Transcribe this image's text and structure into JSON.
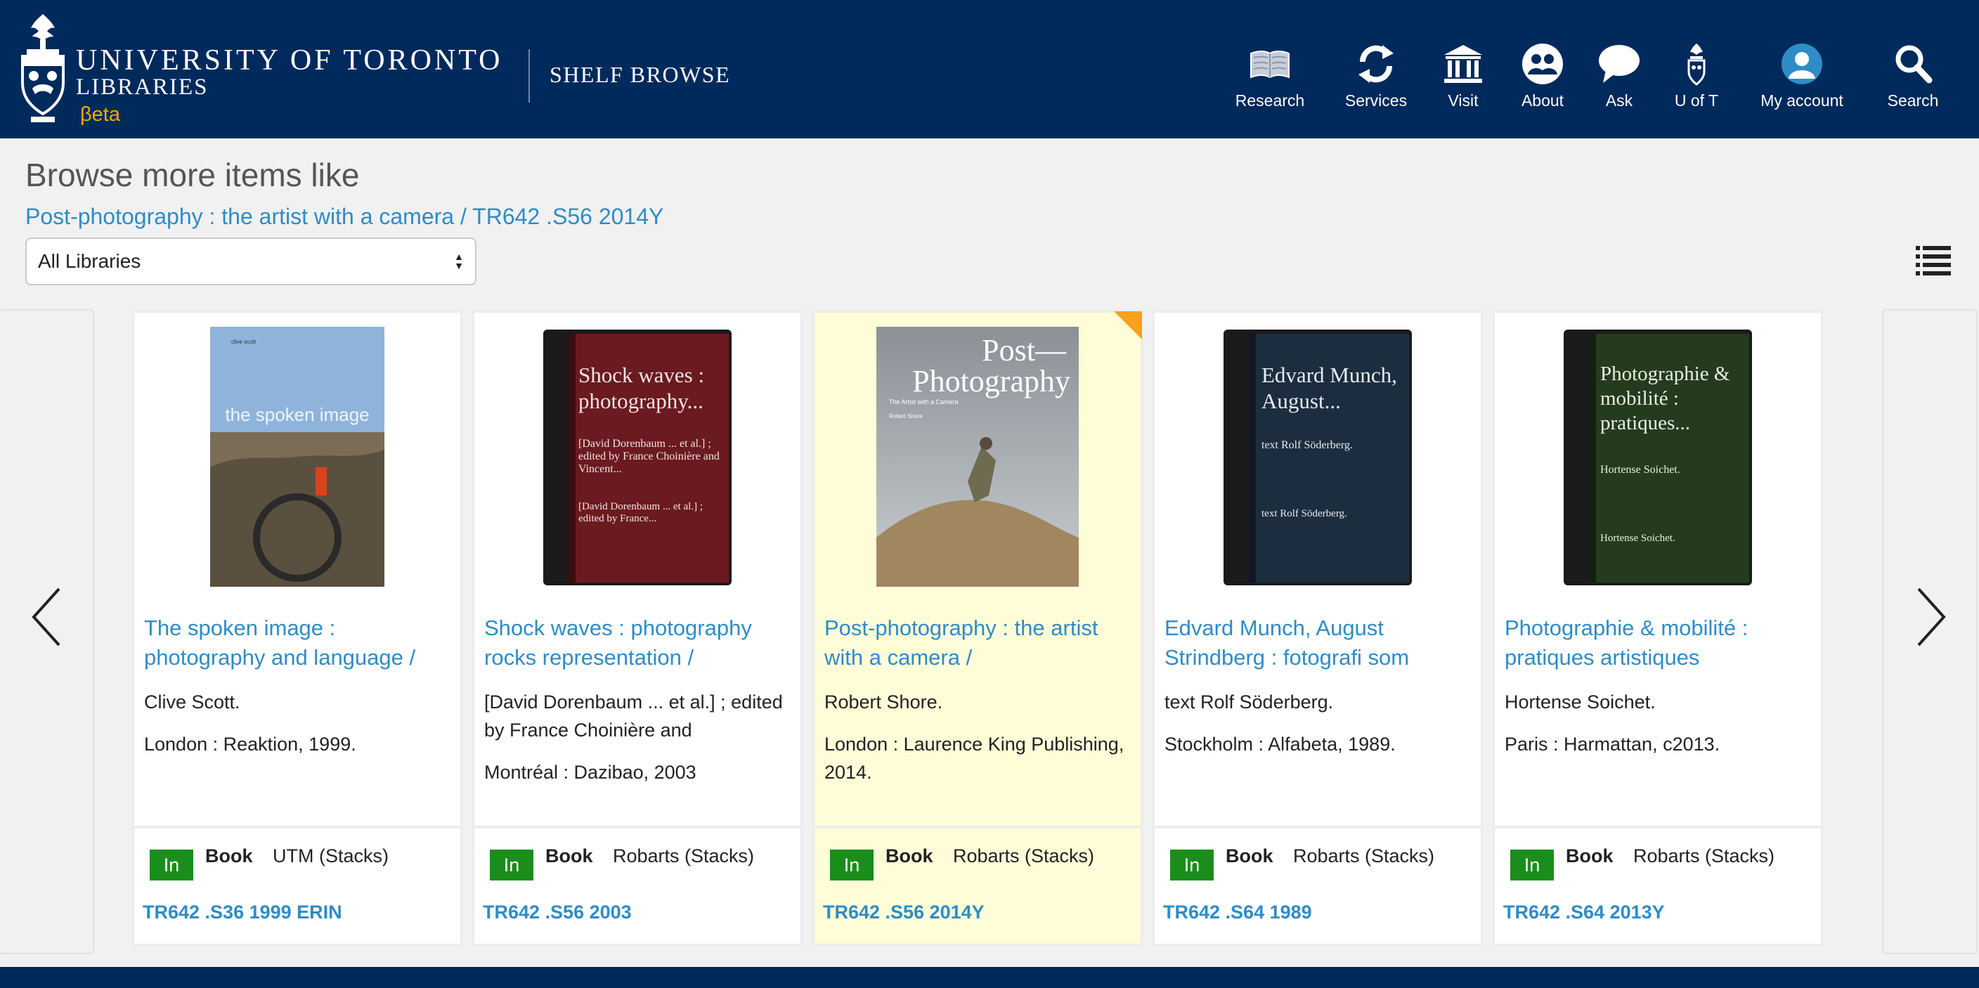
{
  "header": {
    "org_line1": "UNIVERSITY OF TORONTO",
    "org_line2": "LIBRARIES",
    "beta": "βeta",
    "app_title": "SHELF BROWSE",
    "nav": [
      {
        "label": "Research",
        "icon": "book-icon"
      },
      {
        "label": "Services",
        "icon": "refresh-icon"
      },
      {
        "label": "Visit",
        "icon": "building-icon"
      },
      {
        "label": "About",
        "icon": "people-icon"
      },
      {
        "label": "Ask",
        "icon": "chat-bubble-icon"
      },
      {
        "label": "U of T",
        "icon": "crest-icon"
      },
      {
        "label": "My account",
        "icon": "user-icon"
      },
      {
        "label": "Search",
        "icon": "search-icon"
      }
    ]
  },
  "browse": {
    "heading": "Browse more items like",
    "current_item": "Post-photography : the artist with a camera / TR642 .S56 2014Y",
    "library_filter": "All Libraries"
  },
  "items": [
    {
      "title": "The spoken image : photography and language /",
      "author": "Clive Scott.",
      "publication": "London : Reaktion, 1999.",
      "status": "In",
      "type": "Book",
      "location": "UTM (Stacks)",
      "call_number": "TR642 .S36 1999 ERIN",
      "cover_text": "the spoken image",
      "cover_small_text": "clive scott"
    },
    {
      "title": "Shock waves : photography rocks representation /",
      "author": "[David Dorenbaum ... et al.] ; edited by France Choinière and",
      "publication": "Montréal : Dazibao, 2003",
      "status": "In",
      "type": "Book",
      "location": "Robarts (Stacks)",
      "call_number": "TR642 .S56 2003",
      "cover_title": "Shock waves : photography...",
      "cover_author": "[David Dorenbaum ... et al.] ; edited by France Choinière and Vincent...",
      "cover_footer": "[David Dorenbaum ... et al.] ; edited by France...",
      "cover_color": "#6b1a1f"
    },
    {
      "title": "Post-photography : the artist with a camera /",
      "author": "Robert Shore.",
      "publication": "London : Laurence King Publishing, 2014.",
      "status": "In",
      "type": "Book",
      "location": "Robarts (Stacks)",
      "call_number": "TR642 .S56 2014Y",
      "cover_line1": "Post—",
      "cover_line2": "Photography",
      "cover_sub": "The Artist with a Camera",
      "cover_small": "Robert Shore"
    },
    {
      "title": "Edvard Munch, August Strindberg : fotografi som",
      "author": "text Rolf Söderberg.",
      "publication": "Stockholm : Alfabeta, 1989.",
      "status": "In",
      "type": "Book",
      "location": "Robarts (Stacks)",
      "call_number": "TR642 .S64 1989",
      "cover_title": "Edvard Munch, August...",
      "cover_author": "text Rolf Söderberg.",
      "cover_footer": "text Rolf Söderberg.",
      "cover_color": "#1c2d3f"
    },
    {
      "title": "Photographie & mobilité : pratiques artistiques",
      "author": "Hortense Soichet.",
      "publication": "Paris : Harmattan, c2013.",
      "status": "In",
      "type": "Book",
      "location": "Robarts (Stacks)",
      "call_number": "TR642 .S64 2013Y",
      "cover_title": "Photographie & mobilité : pratiques...",
      "cover_author": "Hortense Soichet.",
      "cover_footer": "Hortense Soichet.",
      "cover_color": "#243b1d"
    }
  ],
  "colors": {
    "header_bg": "#002a5c",
    "link": "#2e8cc7",
    "beta": "#f2a900",
    "status_in": "#1a8e1a",
    "current_highlight": "#fffdd8",
    "current_marker": "#f5a31a"
  }
}
